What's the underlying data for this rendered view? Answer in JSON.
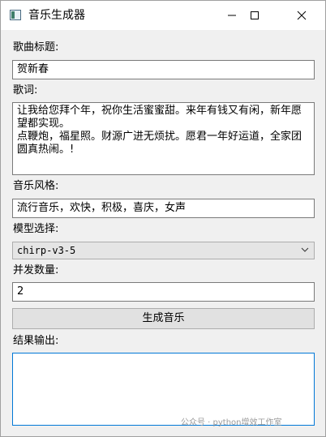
{
  "window": {
    "title": "音乐生成器",
    "icons": {
      "app": "app-icon",
      "minimize": "minimize-icon",
      "maximize": "maximize-icon",
      "close": "close-icon"
    }
  },
  "form": {
    "song_title_label": "歌曲标题:",
    "song_title_value": "贺新春",
    "lyrics_label": "歌词:",
    "lyrics_value": "让我给您拜个年，祝你生活蜜蜜甜。来年有钱又有闲，新年愿望都实现。\n点鞭炮，福星照。财源广进无烦扰。愿君一年好运道，全家团圆真热闹。!",
    "style_label": "音乐风格:",
    "style_value": "流行音乐，欢快，积极，喜庆，女声",
    "model_label": "模型选择:",
    "model_value": "chirp-v3-5",
    "concurrency_label": "并发数量:",
    "concurrency_value": "2",
    "generate_button": "生成音乐",
    "output_label": "结果输出:",
    "output_value": ""
  },
  "watermark": "公众号 · python增效工作室"
}
